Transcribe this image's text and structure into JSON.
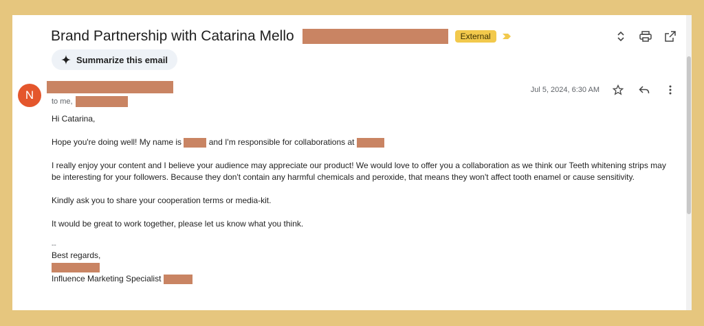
{
  "email": {
    "subject": "Brand Partnership with Catarina Mello",
    "external_badge": "External",
    "summarize_label": "Summarize this email",
    "avatar_initial": "N",
    "to_prefix": "to me,",
    "date": "Jul 5, 2024, 6:30 AM",
    "body": {
      "greeting": "Hi Catarina,",
      "line1_a": "Hope you're doing well! My name is",
      "line1_b": "and I'm responsible for collaborations at",
      "para2": "I really enjoy your content and I believe your audience may appreciate our product! We would love to offer you a collaboration as we think our Teeth whitening strips may be interesting for your followers. Because they don't contain any harmful chemicals and peroxide, that means they won't affect tooth enamel or cause sensitivity.",
      "para3": "Kindly ask you to share your cooperation terms or media-kit.",
      "para4": "It would be great to work together, please let us know what you think.",
      "sig_dash": "--",
      "sig_regards": "Best regards,",
      "sig_title": "Influence Marketing Specialist"
    }
  },
  "icons": {
    "expand": "unfold-icon",
    "print": "print-icon",
    "open": "open-in-new-icon",
    "star": "star-icon",
    "reply": "reply-icon",
    "more": "more-vert-icon",
    "summarize": "sparkle-icon",
    "importance": "importance-marker-icon"
  },
  "colors": {
    "background": "#e6c67e",
    "avatar": "#e4562c",
    "badge": "#f2c94c",
    "redaction": "#c98463"
  }
}
